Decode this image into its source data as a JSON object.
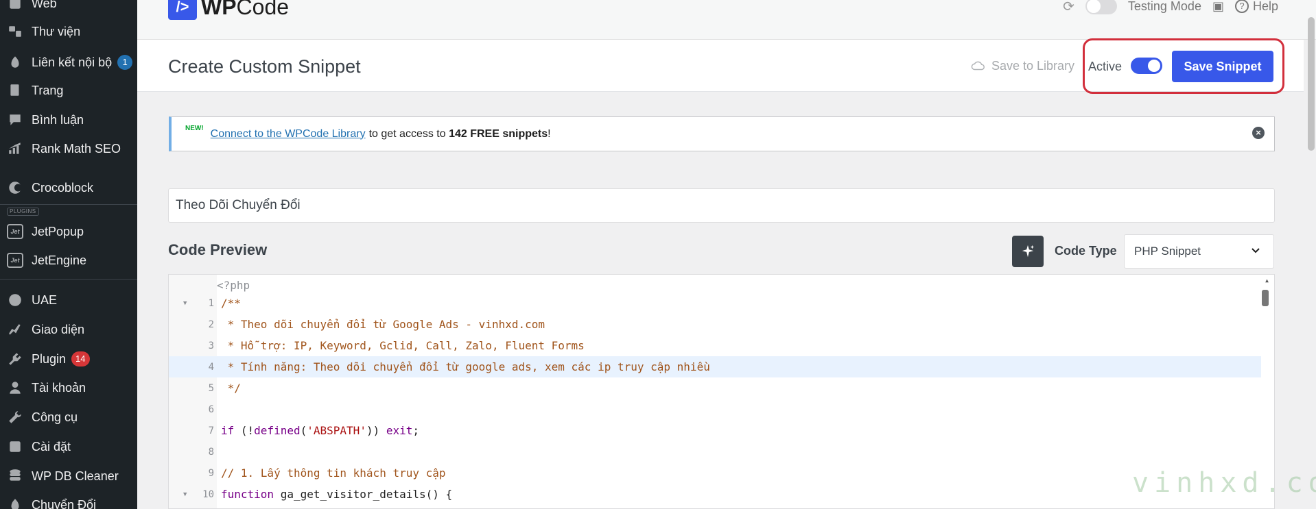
{
  "sidebar": {
    "items": [
      {
        "label": "Web",
        "icon": "media-icon"
      },
      {
        "label": "Thư viện",
        "icon": "library-icon"
      },
      {
        "label": "Liên kết nội bộ",
        "icon": "links-icon",
        "badge": "1"
      },
      {
        "label": "Trang",
        "icon": "pages-icon"
      },
      {
        "label": "Bình luận",
        "icon": "comments-icon"
      },
      {
        "label": "Rank Math SEO",
        "icon": "rank-math-icon"
      },
      {
        "label": "Crocoblock",
        "icon": "crocoblock-icon"
      },
      {
        "label": "JetPopup",
        "icon": "jet-icon"
      },
      {
        "label": "JetEngine",
        "icon": "jet-icon"
      },
      {
        "label": "UAE",
        "icon": "uae-icon"
      },
      {
        "label": "Giao diện",
        "icon": "appearance-icon"
      },
      {
        "label": "Plugin",
        "icon": "plugin-icon",
        "badge": "14"
      },
      {
        "label": "Tài khoản",
        "icon": "user-icon"
      },
      {
        "label": "Công cụ",
        "icon": "tools-icon"
      },
      {
        "label": "Cài đặt",
        "icon": "settings-icon"
      },
      {
        "label": "WP DB Cleaner",
        "icon": "database-icon"
      },
      {
        "label": "Chuyển Đổi",
        "icon": "convert-icon"
      }
    ],
    "plugins_label": "PLUGINS",
    "jet_icon_text": "Jet"
  },
  "topbar": {
    "logo_mark": "/>",
    "logo_bold": "WP",
    "logo_light": "Code",
    "testing_mode": "Testing Mode",
    "help": "Help"
  },
  "header": {
    "title": "Create Custom Snippet",
    "save_to_library": "Save to Library",
    "active_label": "Active",
    "active": true,
    "save_button": "Save Snippet"
  },
  "notice": {
    "new": "NEW!",
    "link_text": "Connect to the WPCode Library",
    "text_before_bold": "to get access to",
    "bold": "142 FREE snippets",
    "text_after": "!",
    "close": "×"
  },
  "snippet_title": "Theo Dõi Chuyển Đổi",
  "code_preview": {
    "label": "Code Preview",
    "code_type_label": "Code Type",
    "code_type_value": "PHP Snippet"
  },
  "editor": {
    "php_open": "<?php",
    "lines": [
      {
        "n": "1",
        "fold": true,
        "text": "/**"
      },
      {
        "n": "2",
        "text": " * Theo dõi chuyển đổi từ Google Ads - vinhxd.com"
      },
      {
        "n": "3",
        "text": " * Hỗ trợ: IP, Keyword, Gclid, Call, Zalo, Fluent Forms"
      },
      {
        "n": "4",
        "text": " * Tính năng: Theo dõi chuyển đổi từ google ads, xem các ip truy cập nhiều"
      },
      {
        "n": "5",
        "text": " */"
      },
      {
        "n": "6",
        "text": ""
      },
      {
        "n": "7",
        "text": ""
      },
      {
        "n": "8",
        "text": ""
      },
      {
        "n": "9",
        "text": "// 1. Lấy thông tin khách truy cập"
      },
      {
        "n": "10",
        "fold": true,
        "text": ""
      }
    ],
    "line7": {
      "kw1": "if",
      "p1": " (!",
      "kw2": "defined",
      "p2": "(",
      "str": "'ABSPATH'",
      "p3": ")) ",
      "kw3": "exit",
      "p4": ";"
    },
    "line10": {
      "kw": "function",
      "name": " ga_get_visitor_details",
      "rest": "() {"
    }
  },
  "watermark": "vinhxd.com",
  "colors": {
    "sidebar_bg": "#1d2327",
    "accent": "#3858e9",
    "highlight_ring": "#d22f3c"
  }
}
